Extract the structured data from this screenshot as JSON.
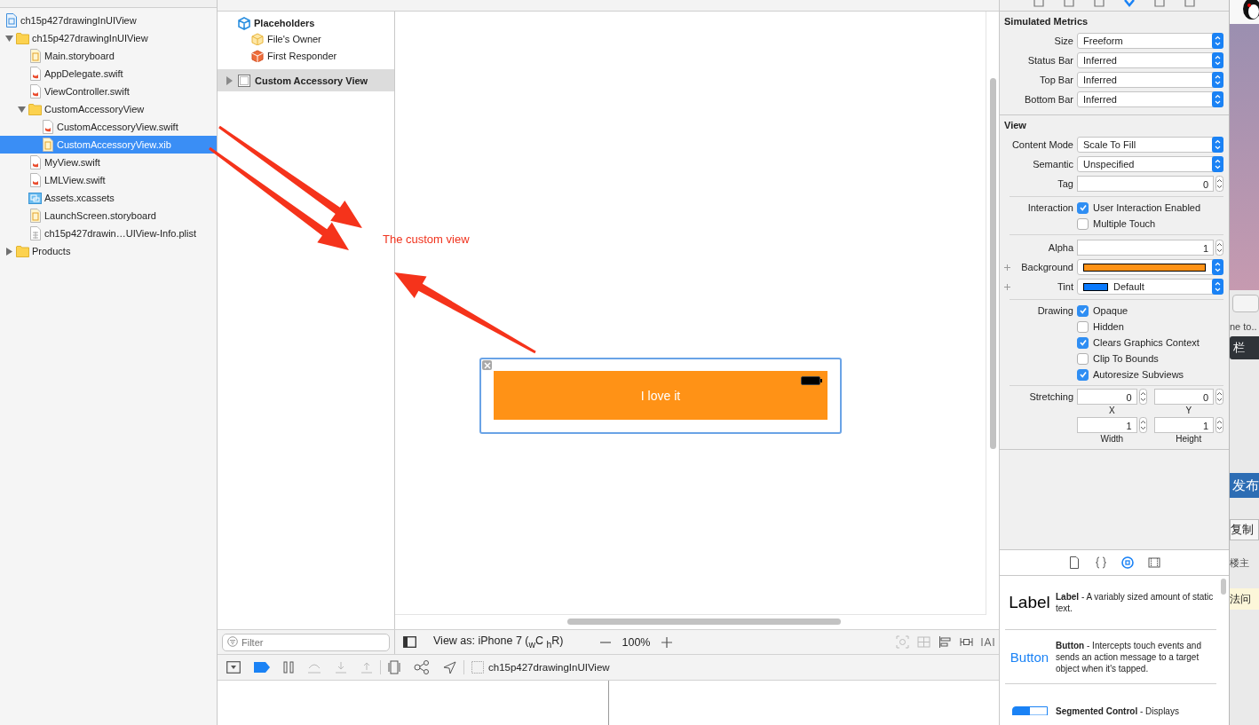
{
  "navigator": {
    "project": {
      "name": "ch15p427drawingInUIView",
      "kind": "project",
      "selected": false,
      "children": [
        {
          "name": "ch15p427drawingInUIView",
          "kind": "folder",
          "expanded": true,
          "selected": false,
          "children": [
            {
              "name": "Main.storyboard",
              "kind": "storyboard",
              "selected": false
            },
            {
              "name": "AppDelegate.swift",
              "kind": "swift",
              "selected": false
            },
            {
              "name": "ViewController.swift",
              "kind": "swift",
              "selected": false
            },
            {
              "name": "CustomAccessoryView",
              "kind": "folder",
              "expanded": true,
              "selected": false,
              "children": [
                {
                  "name": "CustomAccessoryView.swift",
                  "kind": "swift",
                  "selected": false
                },
                {
                  "name": "CustomAccessoryView.xib",
                  "kind": "xib",
                  "selected": true
                }
              ]
            },
            {
              "name": "MyView.swift",
              "kind": "swift",
              "selected": false
            },
            {
              "name": "LMLView.swift",
              "kind": "swift",
              "selected": false
            },
            {
              "name": "Assets.xcassets",
              "kind": "assets",
              "selected": false
            },
            {
              "name": "LaunchScreen.storyboard",
              "kind": "storyboard",
              "selected": false
            },
            {
              "name": "ch15p427drawin…UIView-Info.plist",
              "kind": "plist",
              "selected": false
            }
          ]
        },
        {
          "name": "Products",
          "kind": "folder",
          "expanded": false,
          "selected": false
        }
      ]
    }
  },
  "outline": {
    "placeholders_title": "Placeholders",
    "placeholders": [
      {
        "name": "File's Owner",
        "kind": "owner"
      },
      {
        "name": "First Responder",
        "kind": "responder"
      }
    ],
    "objects": [
      {
        "name": "Custom Accessory View",
        "selected": true,
        "expanded": false
      }
    ],
    "filter_placeholder": "Filter"
  },
  "canvas": {
    "annotation": "The custom view",
    "custom_view": {
      "label": "I love it"
    }
  },
  "canvas_bar": {
    "view_as": "View as: iPhone 7",
    "size_class": "($_{w}$C $_{h}$R)",
    "zoom": "100%"
  },
  "debug_bar": {
    "breakpoints_active": true,
    "target": "ch15p427drawingInUIView"
  },
  "inspector": {
    "tabs": [
      {
        "selected": false
      },
      {
        "selected": false
      },
      {
        "selected": false
      },
      {
        "selected": true
      },
      {
        "selected": false
      },
      {
        "selected": false
      }
    ],
    "simulated_metrics": {
      "title": "Simulated Metrics",
      "rows": [
        {
          "label": "Size",
          "value": "Freeform"
        },
        {
          "label": "Status Bar",
          "value": "Inferred"
        },
        {
          "label": "Top Bar",
          "value": "Inferred"
        },
        {
          "label": "Bottom Bar",
          "value": "Inferred"
        }
      ]
    },
    "view": {
      "title": "View",
      "content_mode": {
        "label": "Content Mode",
        "value": "Scale To Fill"
      },
      "semantic": {
        "label": "Semantic",
        "value": "Unspecified"
      },
      "tag": {
        "label": "Tag",
        "value": "0"
      },
      "interaction": {
        "label": "Interaction",
        "options": [
          {
            "label": "User Interaction Enabled",
            "checked": true
          },
          {
            "label": "Multiple Touch",
            "checked": false
          }
        ]
      },
      "alpha": {
        "label": "Alpha",
        "value": "1"
      },
      "background": {
        "label": "Background",
        "color": "#ff9216"
      },
      "tint": {
        "label": "Tint",
        "value": "Default",
        "color": "#0a7afe"
      },
      "drawing": {
        "label": "Drawing",
        "options": [
          {
            "label": "Opaque",
            "checked": true
          },
          {
            "label": "Hidden",
            "checked": false
          },
          {
            "label": "Clears Graphics Context",
            "checked": true
          },
          {
            "label": "Clip To Bounds",
            "checked": false
          },
          {
            "label": "Autoresize Subviews",
            "checked": true
          }
        ]
      },
      "stretching": {
        "label": "Stretching",
        "fields": [
          {
            "value": "0",
            "caption": "X"
          },
          {
            "value": "0",
            "caption": "Y"
          },
          {
            "value": "1",
            "caption": "Width"
          },
          {
            "value": "1",
            "caption": "Height"
          }
        ]
      }
    }
  },
  "library": {
    "tabs": [
      {
        "selected": false
      },
      {
        "selected": false
      },
      {
        "selected": true
      },
      {
        "selected": false
      }
    ],
    "items": [
      {
        "kind": "label",
        "preview": "Label",
        "description": "**Label** - A variably sized amount of static text."
      },
      {
        "kind": "button",
        "preview": "Button",
        "description": "**Button** - Intercepts touch events and sends an action message to a target object when it's tapped."
      },
      {
        "kind": "segmented",
        "description": "**Segmented Control** - Displays"
      }
    ]
  },
  "background_window": {
    "texts": [
      {
        "kind": "caption",
        "text": "ne to.."
      },
      {
        "kind": "dark-button",
        "text": "栏"
      },
      {
        "kind": "blue-button",
        "text": "发布"
      },
      {
        "kind": "button",
        "text": "复制"
      },
      {
        "kind": "caption",
        "text": "楼主"
      },
      {
        "kind": "highlight",
        "text": "法问"
      }
    ]
  }
}
